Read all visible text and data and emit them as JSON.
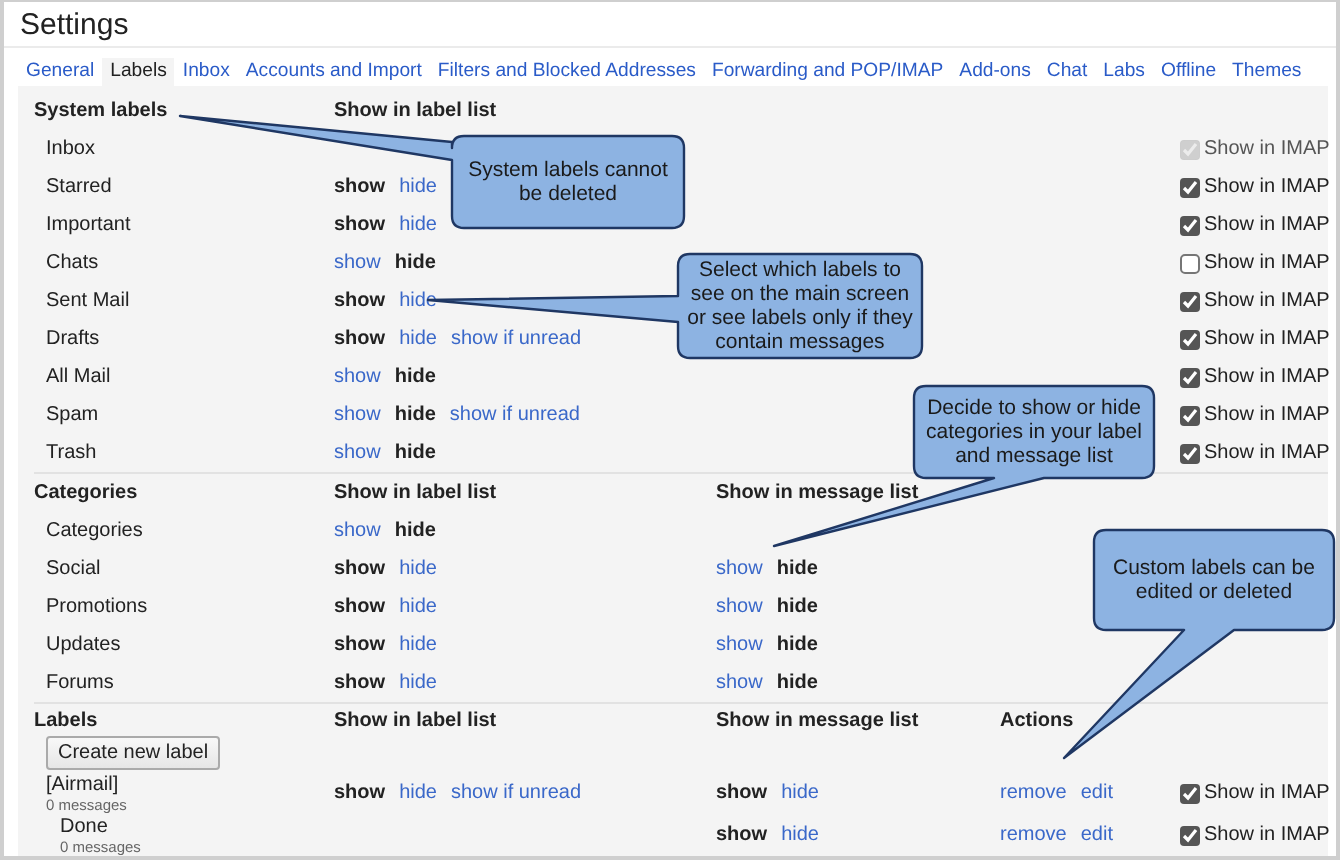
{
  "window": {
    "title": "Settings"
  },
  "tabs": [
    {
      "label": "General",
      "selected": false
    },
    {
      "label": "Labels",
      "selected": true
    },
    {
      "label": "Inbox",
      "selected": false
    },
    {
      "label": "Accounts and Import",
      "selected": false
    },
    {
      "label": "Filters and Blocked Addresses",
      "selected": false
    },
    {
      "label": "Forwarding and POP/IMAP",
      "selected": false
    },
    {
      "label": "Add-ons",
      "selected": false
    },
    {
      "label": "Chat",
      "selected": false
    },
    {
      "label": "Labs",
      "selected": false
    },
    {
      "label": "Offline",
      "selected": false
    },
    {
      "label": "Themes",
      "selected": false
    }
  ],
  "sections": [
    {
      "kind": "system",
      "heading": "System labels",
      "columns": [
        "Show in label list"
      ],
      "rows": [
        {
          "name": "Inbox",
          "imap": {
            "label": "Show in IMAP",
            "checked": true,
            "disabled": true
          }
        },
        {
          "name": "Starred",
          "label_list": [
            {
              "text": "show",
              "selected": true
            },
            {
              "text": "hide",
              "selected": false
            }
          ],
          "imap": {
            "label": "Show in IMAP",
            "checked": true,
            "disabled": false
          }
        },
        {
          "name": "Important",
          "label_list": [
            {
              "text": "show",
              "selected": true
            },
            {
              "text": "hide",
              "selected": false
            }
          ],
          "imap": {
            "label": "Show in IMAP",
            "checked": true,
            "disabled": false
          }
        },
        {
          "name": "Chats",
          "label_list": [
            {
              "text": "show",
              "selected": false
            },
            {
              "text": "hide",
              "selected": true
            }
          ],
          "imap": {
            "label": "Show in IMAP",
            "checked": false,
            "disabled": false
          }
        },
        {
          "name": "Sent Mail",
          "label_list": [
            {
              "text": "show",
              "selected": true
            },
            {
              "text": "hide",
              "selected": false
            }
          ],
          "imap": {
            "label": "Show in IMAP",
            "checked": true,
            "disabled": false
          }
        },
        {
          "name": "Drafts",
          "label_list": [
            {
              "text": "show",
              "selected": true
            },
            {
              "text": "hide",
              "selected": false
            },
            {
              "text": "show if unread",
              "selected": false
            }
          ],
          "imap": {
            "label": "Show in IMAP",
            "checked": true,
            "disabled": false
          }
        },
        {
          "name": "All Mail",
          "label_list": [
            {
              "text": "show",
              "selected": false
            },
            {
              "text": "hide",
              "selected": true
            }
          ],
          "imap": {
            "label": "Show in IMAP",
            "checked": true,
            "disabled": false
          }
        },
        {
          "name": "Spam",
          "label_list": [
            {
              "text": "show",
              "selected": false
            },
            {
              "text": "hide",
              "selected": true
            },
            {
              "text": "show if unread",
              "selected": false
            }
          ],
          "imap": {
            "label": "Show in IMAP",
            "checked": true,
            "disabled": false
          }
        },
        {
          "name": "Trash",
          "label_list": [
            {
              "text": "show",
              "selected": false
            },
            {
              "text": "hide",
              "selected": true
            }
          ],
          "imap": {
            "label": "Show in IMAP",
            "checked": true,
            "disabled": false
          }
        }
      ]
    },
    {
      "kind": "categories",
      "heading": "Categories",
      "columns": [
        "Show in label list",
        "Show in message list"
      ],
      "rows": [
        {
          "name": "Categories",
          "label_list": [
            {
              "text": "show",
              "selected": false
            },
            {
              "text": "hide",
              "selected": true
            }
          ]
        },
        {
          "name": "Social",
          "label_list": [
            {
              "text": "show",
              "selected": true
            },
            {
              "text": "hide",
              "selected": false
            }
          ],
          "message_list": [
            {
              "text": "show",
              "selected": false
            },
            {
              "text": "hide",
              "selected": true
            }
          ]
        },
        {
          "name": "Promotions",
          "label_list": [
            {
              "text": "show",
              "selected": true
            },
            {
              "text": "hide",
              "selected": false
            }
          ],
          "message_list": [
            {
              "text": "show",
              "selected": false
            },
            {
              "text": "hide",
              "selected": true
            }
          ]
        },
        {
          "name": "Updates",
          "label_list": [
            {
              "text": "show",
              "selected": true
            },
            {
              "text": "hide",
              "selected": false
            }
          ],
          "message_list": [
            {
              "text": "show",
              "selected": false
            },
            {
              "text": "hide",
              "selected": true
            }
          ]
        },
        {
          "name": "Forums",
          "label_list": [
            {
              "text": "show",
              "selected": true
            },
            {
              "text": "hide",
              "selected": false
            }
          ],
          "message_list": [
            {
              "text": "show",
              "selected": false
            },
            {
              "text": "hide",
              "selected": true
            }
          ]
        }
      ]
    },
    {
      "kind": "labels",
      "heading": "Labels",
      "columns": [
        "Show in label list",
        "Show in message list",
        "Actions"
      ],
      "button": "Create new label",
      "rows": [
        {
          "name": "[Airmail]",
          "count": "0 messages",
          "label_list": [
            {
              "text": "show",
              "selected": true
            },
            {
              "text": "hide",
              "selected": false
            },
            {
              "text": "show if unread",
              "selected": false
            }
          ],
          "message_list": [
            {
              "text": "show",
              "selected": true
            },
            {
              "text": "hide",
              "selected": false
            }
          ],
          "actions": [
            "remove",
            "edit"
          ],
          "imap": {
            "label": "Show in IMAP",
            "checked": true,
            "disabled": false
          },
          "children": [
            {
              "name": "Done",
              "count": "0 messages",
              "message_list": [
                {
                  "text": "show",
                  "selected": true
                },
                {
                  "text": "hide",
                  "selected": false
                }
              ],
              "actions": [
                "remove",
                "edit"
              ],
              "imap": {
                "label": "Show in IMAP",
                "checked": true,
                "disabled": false
              }
            }
          ]
        }
      ]
    }
  ],
  "callouts": [
    {
      "text": "System labels cannot be deleted"
    },
    {
      "text": "Select which labels to see on the main screen or see labels only if they contain messages"
    },
    {
      "text": "Decide to show or hide categories in your label and message list"
    },
    {
      "text": "Custom labels can be edited or deleted"
    }
  ]
}
